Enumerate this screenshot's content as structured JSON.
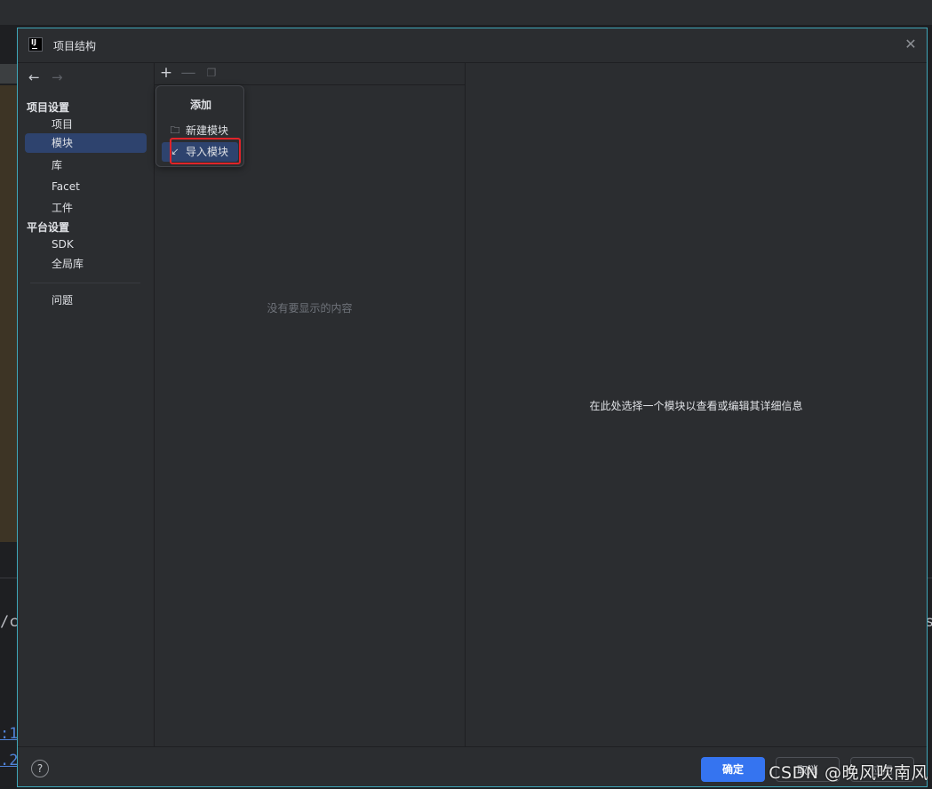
{
  "background": {
    "code_fragment": "/c",
    "link_1": ":1",
    "link_2": ".2",
    "right_fragment": "s"
  },
  "dialog": {
    "title": "项目结构",
    "app_icon_text": "IJ",
    "close_icon": "close-icon"
  },
  "sidebar": {
    "back_arrow": "←",
    "forward_arrow": "→",
    "project_settings_header": "项目设置",
    "project_items": [
      {
        "label": "项目"
      },
      {
        "label": "模块",
        "selected": true
      },
      {
        "label": "库"
      },
      {
        "label": "Facet"
      },
      {
        "label": "工件"
      }
    ],
    "platform_settings_header": "平台设置",
    "platform_items": [
      {
        "label": "SDK"
      },
      {
        "label": "全局库"
      }
    ],
    "problems_label": "问题"
  },
  "middle": {
    "toolbar": {
      "add_icon": "plus-icon",
      "remove_icon": "minus-icon",
      "copy_icon": "copy-icon"
    },
    "empty_text": "没有要显示的内容"
  },
  "popup": {
    "title": "添加",
    "items": [
      {
        "label": "新建模块",
        "icon": "new-module-folder-icon"
      },
      {
        "label": "导入模块",
        "icon": "import-arrow-icon",
        "highlighted": true
      }
    ],
    "highlight_color": "#e0242a"
  },
  "detail": {
    "placeholder_text": "在此处选择一个模块以查看或编辑其详细信息"
  },
  "bottom": {
    "help_label": "?",
    "ok_label": "确定",
    "cancel_label": "取消",
    "apply_label": "应用"
  },
  "colors": {
    "accent": "#3574f0",
    "selection": "#2e436e",
    "dialog_border": "#3fa7b9"
  },
  "watermark": "CSDN @晚风吹南风"
}
